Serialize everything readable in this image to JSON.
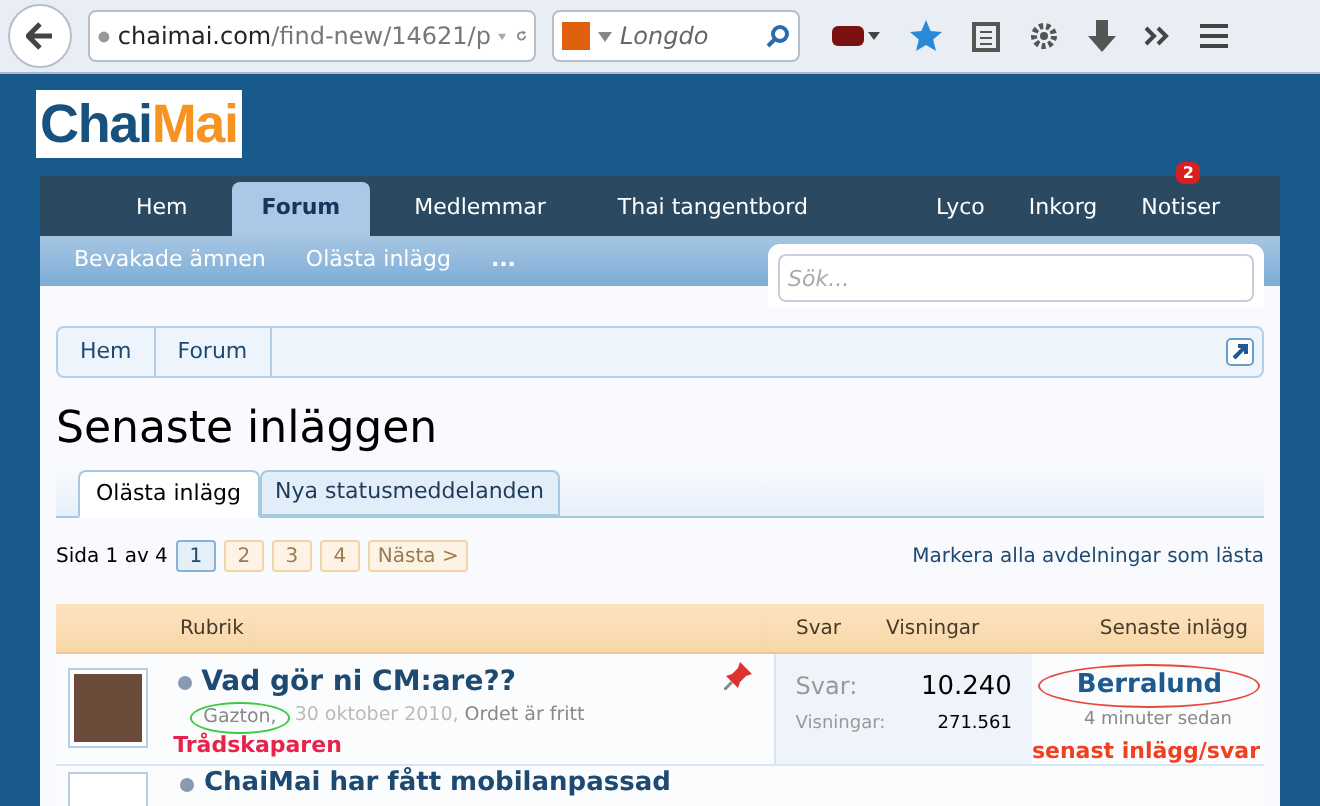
{
  "browser": {
    "url_domain": "chaimai.com",
    "url_path": "/find-new/14621/p",
    "search_placeholder": "Longdo"
  },
  "logo": {
    "part1": "Chai",
    "part2": "Mai"
  },
  "nav": {
    "tabs": [
      {
        "label": "Hem",
        "selected": false
      },
      {
        "label": "Forum",
        "selected": true
      },
      {
        "label": "Medlemmar",
        "selected": false
      },
      {
        "label": "Thai tangentbord",
        "selected": false
      }
    ],
    "right": [
      {
        "label": "Lyco"
      },
      {
        "label": "Inkorg"
      },
      {
        "label": "Notiser",
        "badge": "2"
      }
    ]
  },
  "subnav": [
    "Bevakade ämnen",
    "Olästa inlägg",
    "..."
  ],
  "search": {
    "placeholder": "Sök..."
  },
  "breadcrumb": [
    "Hem",
    "Forum"
  ],
  "title": "Senaste inläggen",
  "tabs": [
    {
      "label": "Olästa inlägg",
      "selected": true
    },
    {
      "label": "Nya statusmeddelanden",
      "selected": false
    }
  ],
  "pagination": {
    "label": "Sida 1 av 4",
    "pages": [
      {
        "label": "1",
        "selected": true
      },
      {
        "label": "2",
        "selected": false
      },
      {
        "label": "3",
        "selected": false
      },
      {
        "label": "4",
        "selected": false
      }
    ],
    "next": "Nästa >"
  },
  "mark_all": "Markera alla avdelningar som lästa",
  "table": {
    "columns": [
      "Rubrik",
      "Svar",
      "Visningar",
      "Senaste inlägg"
    ],
    "rows": [
      {
        "title": "Vad gör ni CM:are??",
        "author": "Gazton,",
        "date": "30 oktober 2010,",
        "forum": "Ordet är fritt",
        "sticky": true,
        "replies_label": "Svar:",
        "replies": "10.240",
        "views_label": "Visningar:",
        "views": "271.561",
        "last_user": "Berralund",
        "last_time": "4 minuter sedan"
      },
      {
        "title": "ChaiMai har fått mobilanpassad",
        "sticky": false
      }
    ]
  },
  "annotations": {
    "author_note": "Trådskaparen",
    "last_note": "senast inlägg/svar"
  }
}
